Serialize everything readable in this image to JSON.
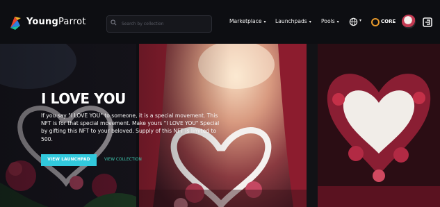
{
  "brand": {
    "name_bold": "Young",
    "name_rest": "Parrot"
  },
  "search": {
    "placeholder": "Search by collection"
  },
  "nav": {
    "marketplace": "Marketplace",
    "launchpads": "Launchpads",
    "pools": "Pools",
    "currency": "CORE"
  },
  "icons": [
    "logo-icon",
    "search-icon",
    "globe-icon",
    "core-coin-icon",
    "avatar",
    "logout-icon"
  ],
  "hero": {
    "title": "I LOVE YOU",
    "description": "If you say \"I LOVE YOU\" to someone, it is a special movement. This NFT is for that special movement. Make yours \"I LOVE YOU\" Special by gifting this NFT to your beloved. Supply of this NFT is limited to 500.",
    "primary_button": "VIEW LAUNCHPAD",
    "secondary_link": "VIEW COLLECTION"
  },
  "colors": {
    "nav_bg": "#0d0e12",
    "accent": "#31c9dc",
    "core": "#e89a2c"
  }
}
